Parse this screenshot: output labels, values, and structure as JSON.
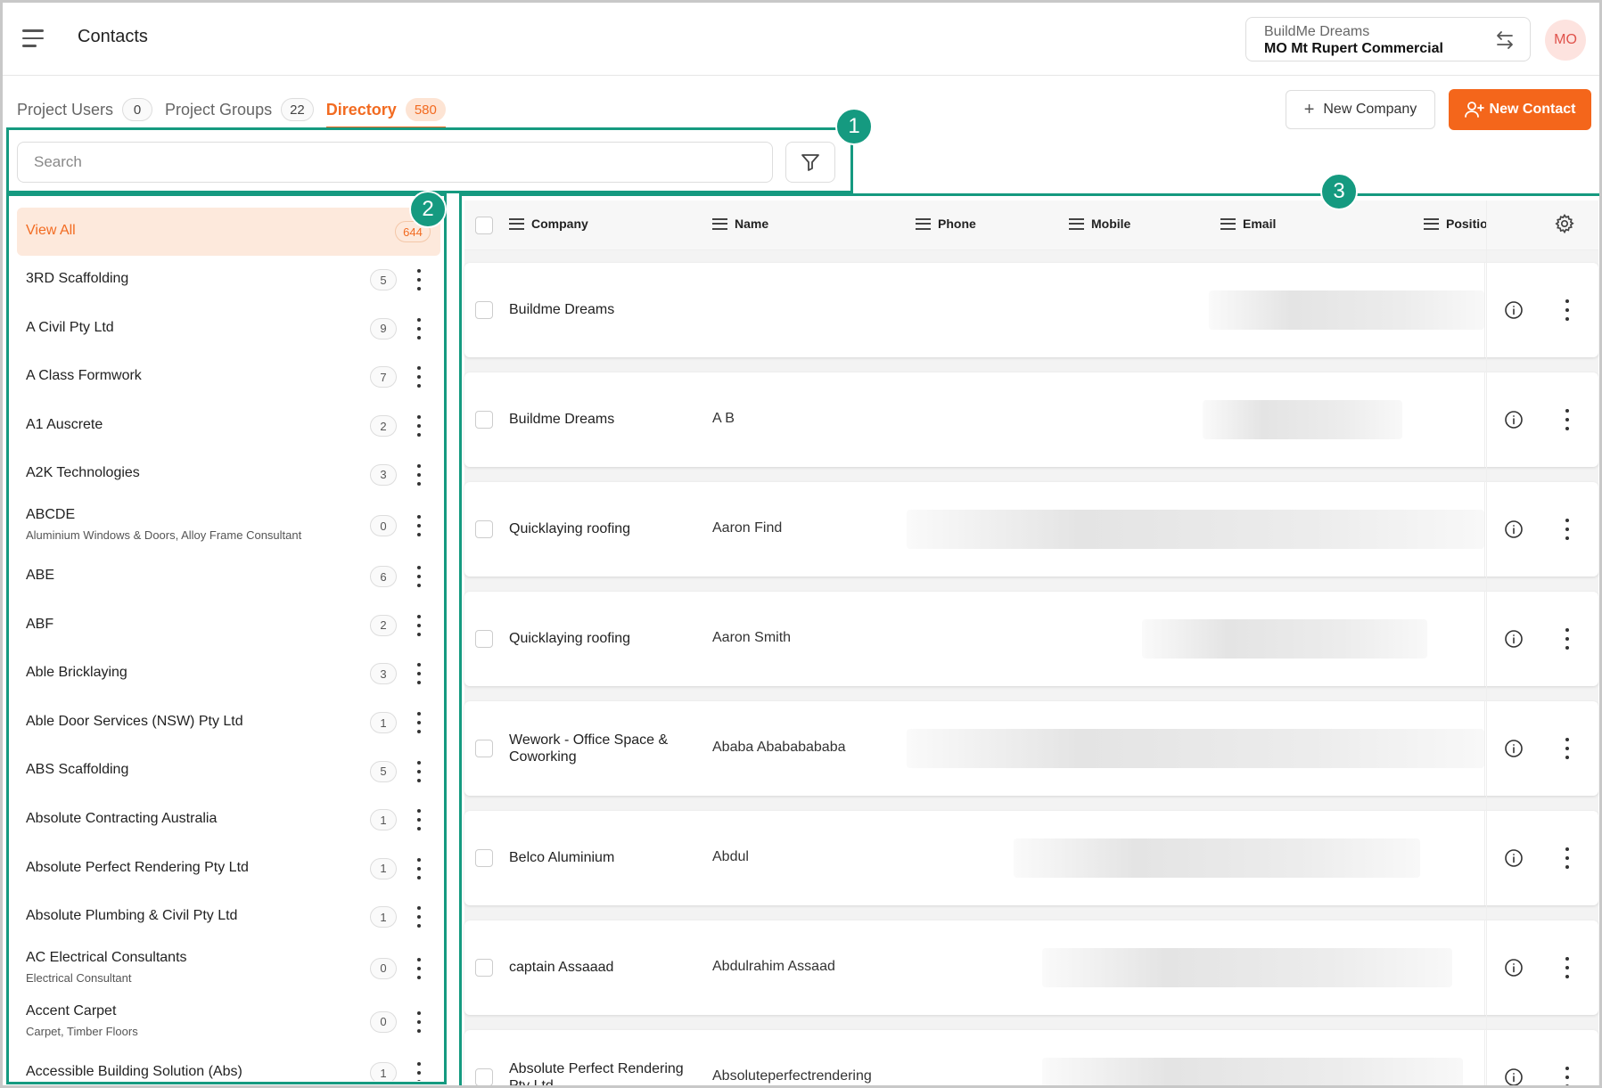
{
  "header": {
    "title": "Contacts",
    "project_org": "BuildMe Dreams",
    "project_name": "MO Mt Rupert Commercial",
    "avatar_initials": "MO"
  },
  "tabs": [
    {
      "label": "Project Users",
      "count": "0",
      "active": false
    },
    {
      "label": "Project Groups",
      "count": "22",
      "active": false
    },
    {
      "label": "Directory",
      "count": "580",
      "active": true
    }
  ],
  "actions": {
    "new_company": "New Company",
    "new_contact": "New Contact"
  },
  "search": {
    "placeholder": "Search",
    "value": ""
  },
  "regions": {
    "search_region": "1",
    "sidebar_region": "2",
    "table_region": "3"
  },
  "sidebar": {
    "view_all": {
      "label": "View All",
      "count": "644"
    },
    "items": [
      {
        "name": "3RD Scaffolding",
        "sub": "",
        "count": "5"
      },
      {
        "name": "A Civil Pty Ltd",
        "sub": "",
        "count": "9"
      },
      {
        "name": "A Class Formwork",
        "sub": "",
        "count": "7"
      },
      {
        "name": "A1 Auscrete",
        "sub": "",
        "count": "2"
      },
      {
        "name": "A2K Technologies",
        "sub": "",
        "count": "3"
      },
      {
        "name": "ABCDE",
        "sub": "Aluminium Windows & Doors, Alloy Frame Consultant",
        "count": "0"
      },
      {
        "name": "ABE",
        "sub": "",
        "count": "6"
      },
      {
        "name": "ABF",
        "sub": "",
        "count": "2"
      },
      {
        "name": "Able Bricklaying",
        "sub": "",
        "count": "3"
      },
      {
        "name": "Able Door Services (NSW) Pty Ltd",
        "sub": "",
        "count": "1"
      },
      {
        "name": "ABS Scaffolding",
        "sub": "",
        "count": "5"
      },
      {
        "name": "Absolute Contracting Australia",
        "sub": "",
        "count": "1"
      },
      {
        "name": "Absolute Perfect Rendering Pty Ltd",
        "sub": "",
        "count": "1"
      },
      {
        "name": "Absolute Plumbing & Civil Pty Ltd",
        "sub": "",
        "count": "1"
      },
      {
        "name": "AC Electrical Consultants",
        "sub": "Electrical Consultant",
        "count": "0"
      },
      {
        "name": "Accent Carpet",
        "sub": "Carpet, Timber Floors",
        "count": "0"
      },
      {
        "name": "Accessible Building Solution (Abs)",
        "sub": "",
        "count": "1"
      }
    ]
  },
  "table": {
    "columns": [
      "Company",
      "Name",
      "Phone",
      "Mobile",
      "Email",
      "Positio"
    ],
    "rows": [
      {
        "company": "Buildme Dreams",
        "name": ""
      },
      {
        "company": "Buildme Dreams",
        "name": "A B"
      },
      {
        "company": "Quicklaying roofing",
        "name": "Aaron Find"
      },
      {
        "company": "Quicklaying roofing",
        "name": "Aaron Smith"
      },
      {
        "company": "Wework - Office Space & Coworking",
        "name": "Ababa Abababababa"
      },
      {
        "company": "Belco Aluminium",
        "name": "Abdul"
      },
      {
        "company": "captain Assaaad",
        "name": "Abdulrahim Assaad"
      },
      {
        "company": "Absolute Perfect Rendering Pty Ltd",
        "name": "Absoluteperfectrendering"
      }
    ]
  },
  "colors": {
    "accent": "#f26b21",
    "annotation": "#159a80"
  },
  "icons": {
    "menu": "hamburger-menu-icon",
    "swap": "swap-arrows-icon",
    "filter": "filter-funnel-icon",
    "settings": "gear-icon",
    "info": "info-circle-icon",
    "more": "kebab-vertical-icon",
    "add_user": "add-user-icon"
  }
}
